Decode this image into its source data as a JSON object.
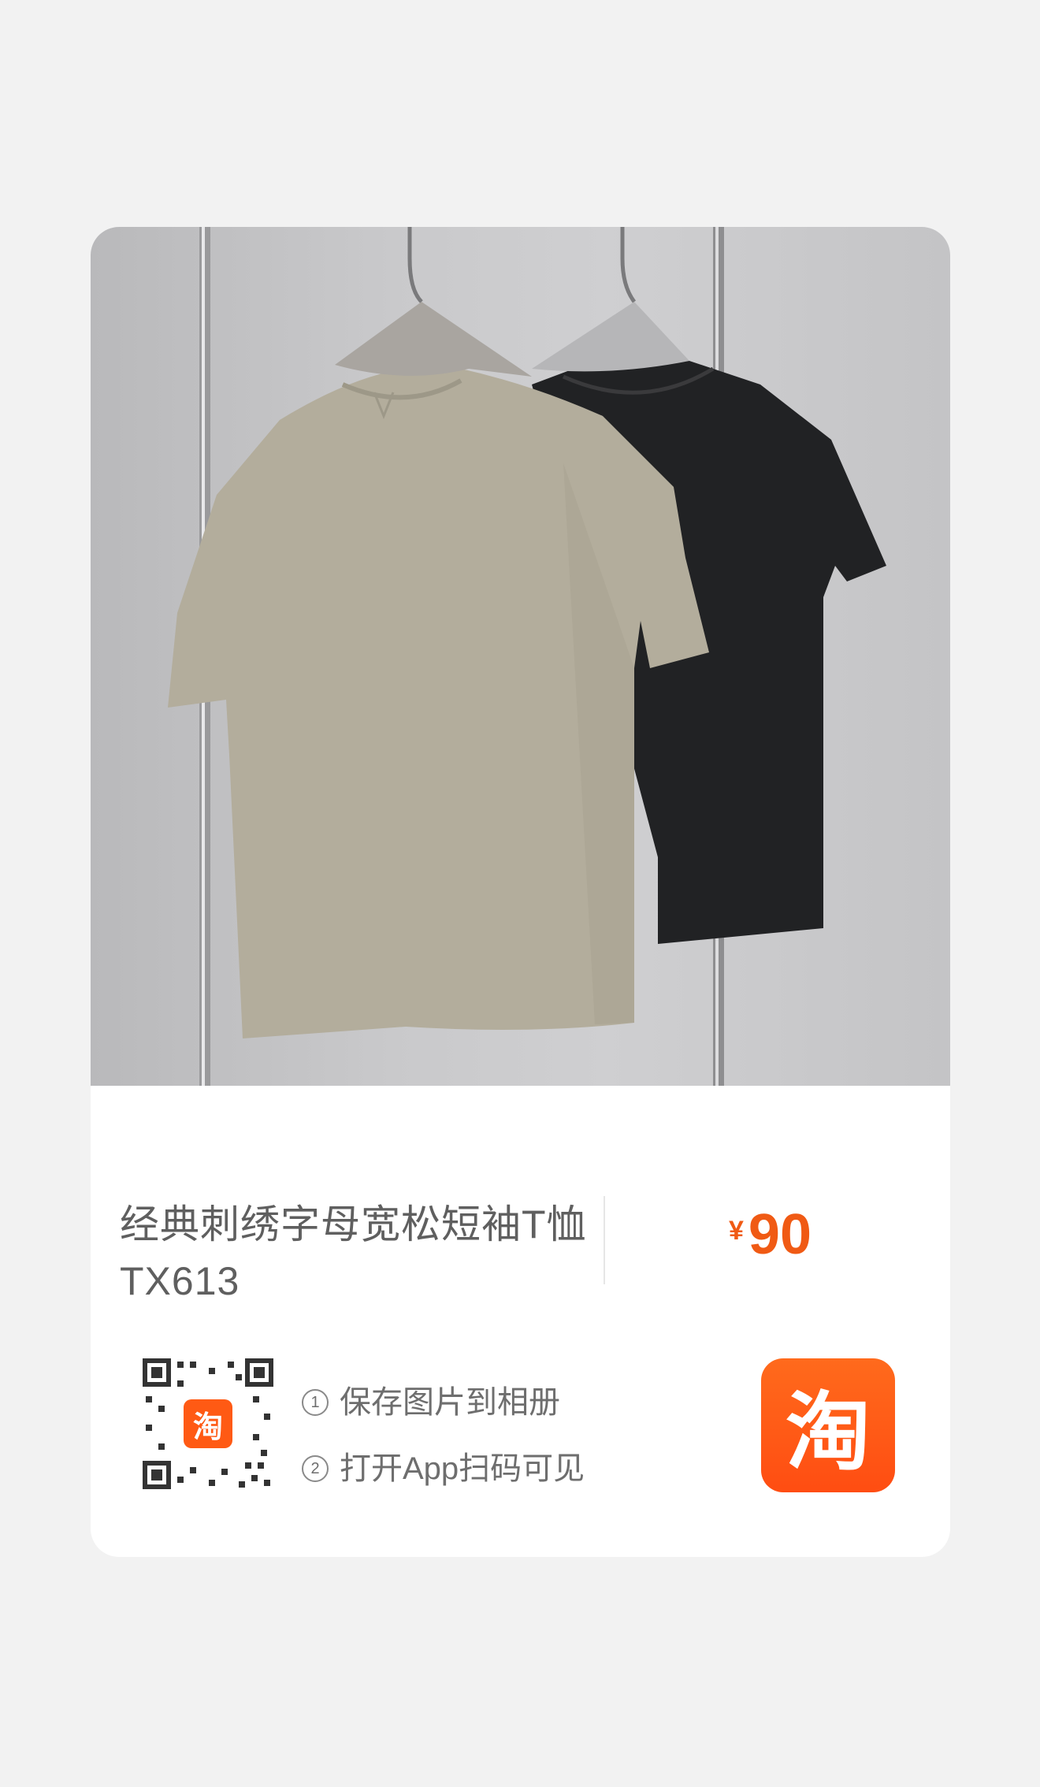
{
  "product": {
    "title_line1": "经典刺绣字母宽松短袖T恤",
    "title_line2": "TX613",
    "price_currency": "¥",
    "price_value": "90"
  },
  "share": {
    "steps": [
      {
        "num": "1",
        "text": "保存图片到相册"
      },
      {
        "num": "2",
        "text": "打开App扫码可见"
      }
    ],
    "qr_badge": "淘",
    "app_logo": "淘"
  },
  "colors": {
    "accent": "#f05a14",
    "logo": "#ff5a14"
  },
  "icons": {
    "qr": "qr-code-icon",
    "app": "taobao-logo-icon"
  }
}
